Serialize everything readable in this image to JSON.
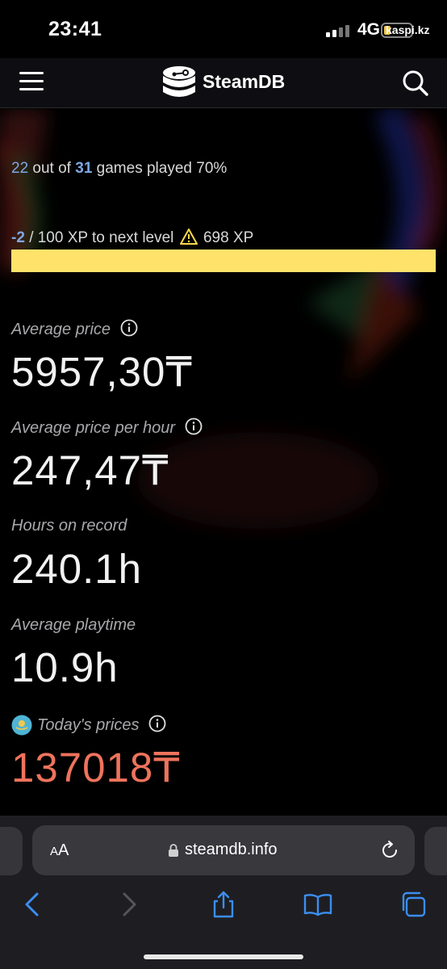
{
  "status": {
    "time": "23:41",
    "network": "4G",
    "carrier": "kaspi.kz"
  },
  "header": {
    "brand": "SteamDB",
    "menu_icon": "hamburger-menu-icon",
    "search_icon": "search-icon",
    "logo_icon": "steamdb-logo-icon"
  },
  "games": {
    "played": "22",
    "out_of": "out of",
    "total": "31",
    "suffix": "games played 70%"
  },
  "xp": {
    "current": "-2",
    "rest": "/ 100 XP to next level",
    "warn_icon": "warning-icon",
    "total": "698 XP",
    "progress_percent": 0,
    "bar_color": "#ffe26a"
  },
  "stats": {
    "avg_price_label": "Average price",
    "avg_price_value": "5957,30₸",
    "avg_price_hour_label": "Average price per hour",
    "avg_price_hour_value": "247,47₸",
    "hours_label": "Hours on record",
    "hours_value": "240.1h",
    "avg_playtime_label": "Average playtime",
    "avg_playtime_value": "10.9h",
    "today_label": "Today's prices",
    "today_value": "137018₸",
    "today_color": "#ee735c",
    "flag_icon": "kazakhstan-flag-icon",
    "info_icon": "info-icon"
  },
  "browser": {
    "text_size": "AA",
    "url": "steamdb.info",
    "nav": [
      "back-icon",
      "forward-icon",
      "share-icon",
      "bookmarks-icon",
      "tabs-icon"
    ]
  }
}
